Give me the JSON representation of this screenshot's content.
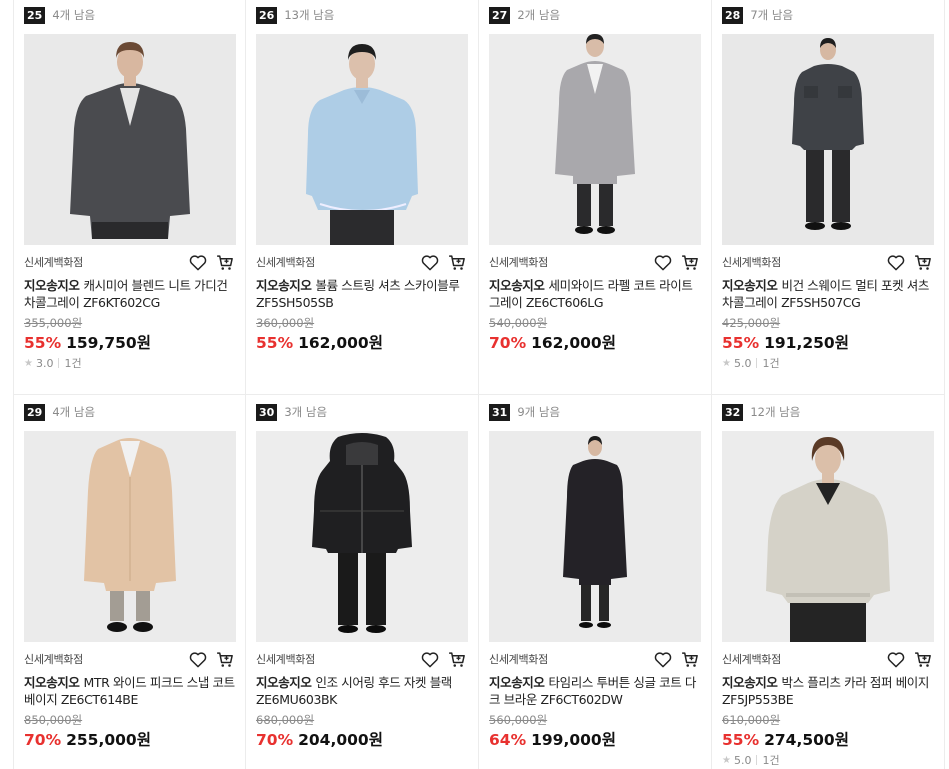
{
  "products": [
    {
      "rank": "25",
      "stock": "4개 남음",
      "seller": "신세계백화점",
      "brand": "지오송지오",
      "name": "캐시미어 블렌드 니트 가디건 차콜그레이 ZF6KT602CG",
      "original_price": "355,000원",
      "discount": "55%",
      "price": "159,750원",
      "rating": "3.0",
      "reviews": "1건",
      "icons": [
        "heart-icon",
        "cart-icon",
        "star-icon"
      ]
    },
    {
      "rank": "26",
      "stock": "13개 남음",
      "seller": "신세계백화점",
      "brand": "지오송지오",
      "name": "볼륨 스트링 셔츠 스카이블루 ZF5SH505SB",
      "original_price": "360,000원",
      "discount": "55%",
      "price": "162,000원",
      "rating": "",
      "reviews": "",
      "icons": [
        "heart-icon",
        "cart-icon"
      ]
    },
    {
      "rank": "27",
      "stock": "2개 남음",
      "seller": "신세계백화점",
      "brand": "지오송지오",
      "name": "세미와이드 라펠 코트 라이트그레이 ZE6CT606LG",
      "original_price": "540,000원",
      "discount": "70%",
      "price": "162,000원",
      "rating": "",
      "reviews": "",
      "icons": [
        "heart-icon",
        "cart-icon"
      ]
    },
    {
      "rank": "28",
      "stock": "7개 남음",
      "seller": "신세계백화점",
      "brand": "지오송지오",
      "name": "비건 스웨이드 멀티 포켓 셔츠 차콜그레이 ZF5SH507CG",
      "original_price": "425,000원",
      "discount": "55%",
      "price": "191,250원",
      "rating": "5.0",
      "reviews": "1건",
      "icons": [
        "heart-icon",
        "cart-icon",
        "star-icon"
      ]
    },
    {
      "rank": "29",
      "stock": "4개 남음",
      "seller": "신세계백화점",
      "brand": "지오송지오",
      "name": "MTR 와이드 피크드 스냅 코트 베이지 ZE6CT614BE",
      "original_price": "850,000원",
      "discount": "70%",
      "price": "255,000원",
      "rating": "",
      "reviews": "",
      "icons": [
        "heart-icon",
        "cart-icon"
      ]
    },
    {
      "rank": "30",
      "stock": "3개 남음",
      "seller": "신세계백화점",
      "brand": "지오송지오",
      "name": "인조 시어링 후드 자켓 블랙 ZE6MU603BK",
      "original_price": "680,000원",
      "discount": "70%",
      "price": "204,000원",
      "rating": "",
      "reviews": "",
      "icons": [
        "heart-icon",
        "cart-icon"
      ]
    },
    {
      "rank": "31",
      "stock": "9개 남음",
      "seller": "신세계백화점",
      "brand": "지오송지오",
      "name": "타임리스 투버튼 싱글 코트 다크 브라운 ZF6CT602DW",
      "original_price": "560,000원",
      "discount": "64%",
      "price": "199,000원",
      "rating": "",
      "reviews": "",
      "icons": [
        "heart-icon",
        "cart-icon"
      ]
    },
    {
      "rank": "32",
      "stock": "12개 남음",
      "seller": "신세계백화점",
      "brand": "지오송지오",
      "name": "박스 플리츠 카라 점퍼 베이지 ZF5JP553BE",
      "original_price": "610,000원",
      "discount": "55%",
      "price": "274,500원",
      "rating": "5.0",
      "reviews": "1건",
      "icons": [
        "heart-icon",
        "cart-icon",
        "star-icon"
      ]
    }
  ],
  "colors": {
    "discount": "#e8312f",
    "rank_bg": "#1a1a1a",
    "muted": "#8a8a8a"
  }
}
